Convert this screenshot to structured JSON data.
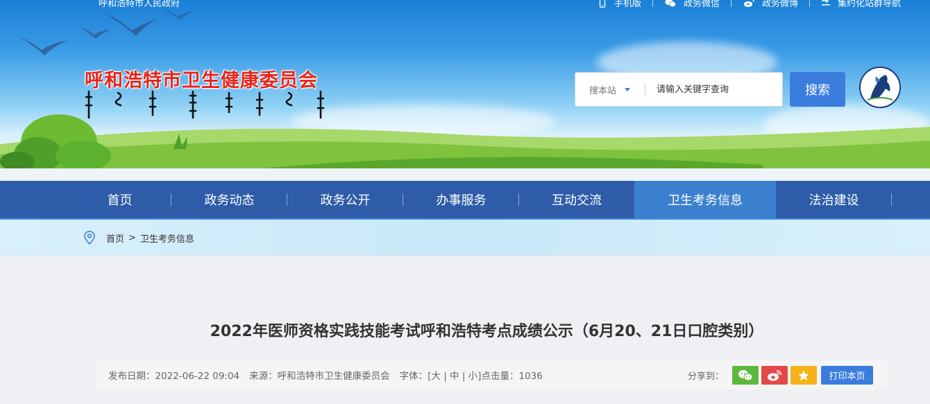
{
  "topbar": {
    "gov_name": "呼和浩特市人民政府",
    "links": [
      {
        "label": "手机版",
        "icon": "mobile-icon"
      },
      {
        "label": "政务微信",
        "icon": "wechat-icon"
      },
      {
        "label": "政务微博",
        "icon": "weibo-icon"
      },
      {
        "label": "集约化站群导航",
        "icon": "sitemap-icon"
      }
    ]
  },
  "header": {
    "site_title": "呼和浩特市卫生健康委员会",
    "search": {
      "scope_label": "搜本站",
      "placeholder": "请输入关键字查询",
      "button_label": "搜索"
    }
  },
  "nav": {
    "items": [
      {
        "label": "首页",
        "active": false
      },
      {
        "label": "政务动态",
        "active": false
      },
      {
        "label": "政务公开",
        "active": false
      },
      {
        "label": "办事服务",
        "active": false
      },
      {
        "label": "互动交流",
        "active": false
      },
      {
        "label": "卫生考务信息",
        "active": true
      },
      {
        "label": "法治建设",
        "active": false
      }
    ]
  },
  "breadcrumb": {
    "home": "首页",
    "separator": ">",
    "current": "卫生考务信息"
  },
  "article": {
    "title": "2022年医师资格实践技能考试呼和浩特考点成绩公示（6月20、21日口腔类别）",
    "meta": {
      "date": "发布日期：2022-06-22 09:04",
      "source": "来源：呼和浩特市卫生健康委员会",
      "font_size": "字体：[大 | 中 | 小]",
      "hits": "点击量：1036"
    },
    "share": {
      "label": "分享到：",
      "print_label": "打印本页"
    }
  },
  "colors": {
    "nav_bg": "#2f5ca8",
    "nav_active": "#3b80cf",
    "accent": "#3b7ddd",
    "title_red": "#e8241b"
  }
}
